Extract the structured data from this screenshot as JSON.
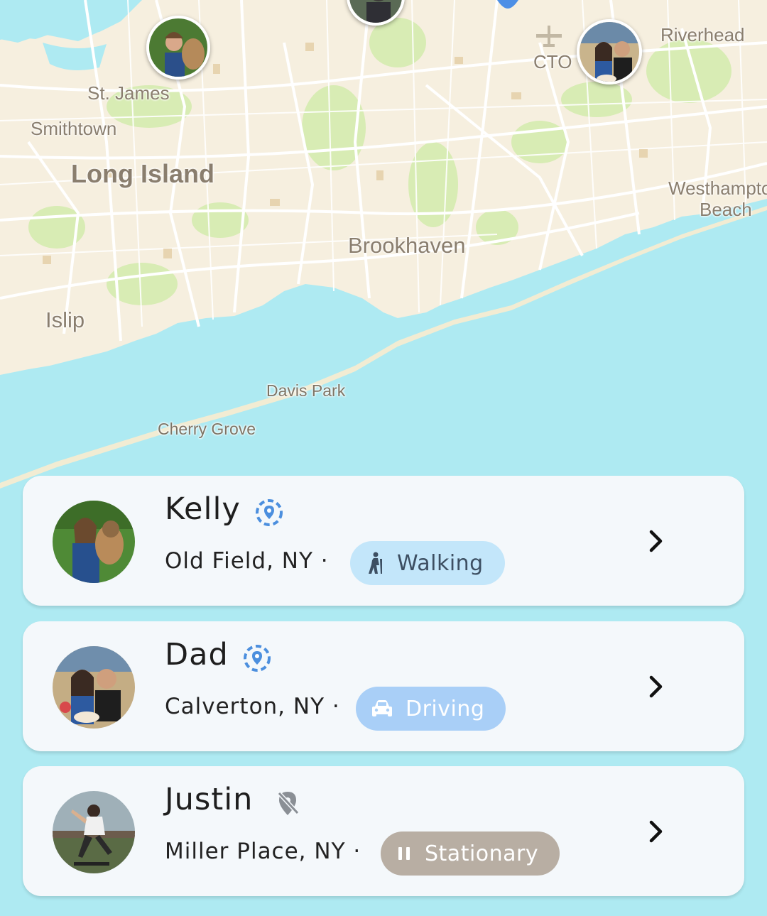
{
  "map": {
    "labels": {
      "st_james": "St. James",
      "smithtown": "Smithtown",
      "long_island": "Long Island",
      "brookhaven": "Brookhaven",
      "islip": "Islip",
      "davis_park": "Davis Park",
      "cherry_grove": "Cherry Grove",
      "cto": "CTO",
      "riverhead": "Riverhead",
      "westhampton": "Westhampto",
      "beach": "Beach"
    },
    "colors": {
      "land": "#f6efdf",
      "water": "#aeeaf2",
      "park": "#d8ecb4",
      "road": "#ffffff"
    }
  },
  "members": [
    {
      "name": "Kelly",
      "location": "Old Field, NY ·",
      "status": "Walking",
      "status_icon": "walking-icon",
      "tracking_icon": "location-tracking-icon",
      "chip_bg": "#c3e6fa",
      "chip_fg": "#3d4f62"
    },
    {
      "name": "Dad",
      "location": "Calverton, NY ·",
      "status": "Driving",
      "status_icon": "car-icon",
      "tracking_icon": "location-tracking-icon",
      "chip_bg": "#a9cff7",
      "chip_fg": "#ffffff"
    },
    {
      "name": "Justin",
      "location": "Miller Place, NY ·",
      "status": "Stationary",
      "status_icon": "pause-icon",
      "tracking_icon": "location-off-icon",
      "chip_bg": "#b8aea3",
      "chip_fg": "#ffffff"
    }
  ]
}
